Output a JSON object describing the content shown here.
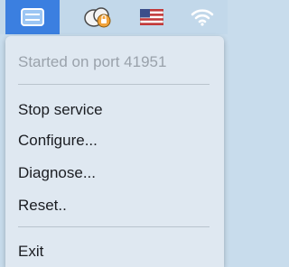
{
  "menubar": {
    "items": [
      {
        "icon": "app-window-icon",
        "active": true,
        "highlight_color": "#3b7fe0"
      },
      {
        "icon": "cloud-sync-icon"
      },
      {
        "icon": "us-flag-icon"
      },
      {
        "icon": "wifi-icon"
      }
    ]
  },
  "menu": {
    "status": "Started on port 41951",
    "items": [
      {
        "label": "Stop service"
      },
      {
        "label": "Configure..."
      },
      {
        "label": "Diagnose..."
      },
      {
        "label": "Reset.."
      }
    ],
    "exit_label": "Exit"
  }
}
